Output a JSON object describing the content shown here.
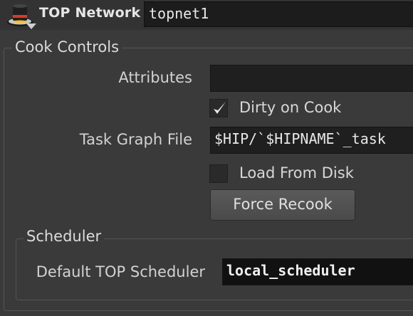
{
  "header": {
    "node_type_label": "TOP Network",
    "node_name": "topnet1",
    "icon": "top-network-hat-icon"
  },
  "cook_controls": {
    "title": "Cook Controls",
    "attributes_label": "Attributes",
    "attributes_value": "",
    "dirty_on_cook_label": "Dirty on Cook",
    "dirty_on_cook_checked": true,
    "task_graph_file_label": "Task Graph File",
    "task_graph_file_value": "$HIP/`$HIPNAME`_task",
    "load_from_disk_label": "Load From Disk",
    "load_from_disk_checked": false,
    "force_recook_label": "Force Recook"
  },
  "scheduler": {
    "title": "Scheduler",
    "default_top_scheduler_label": "Default TOP Scheduler",
    "default_top_scheduler_value": "local_scheduler"
  },
  "colors": {
    "panel_bg": "#3a3a3a",
    "field_bg": "#1f1f1f",
    "text": "#dcdcdc"
  }
}
